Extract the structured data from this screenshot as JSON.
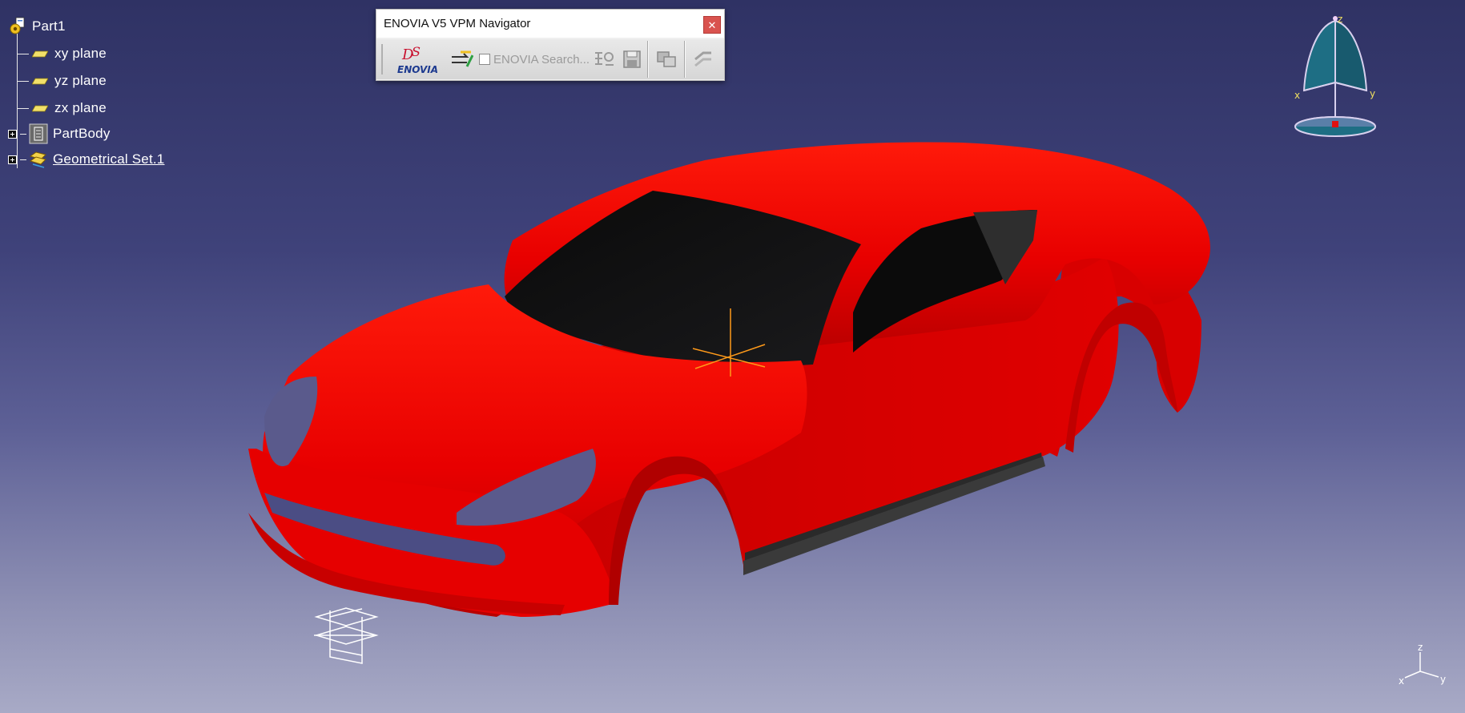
{
  "tree": {
    "root": "Part1",
    "items": [
      {
        "label": "xy plane"
      },
      {
        "label": "yz plane"
      },
      {
        "label": "zx plane"
      },
      {
        "label": "PartBody"
      },
      {
        "label": "Geometrical Set.1"
      }
    ]
  },
  "toolbar": {
    "title": "ENOVIA V5 VPM Navigator",
    "close_label": "✕",
    "logo_text": "ENOVIA",
    "search_label": "ENOVIA Search..."
  },
  "compass": {
    "x_label": "x",
    "y_label": "y",
    "z_label": "z"
  },
  "axes": {
    "x_label": "x",
    "y_label": "y",
    "z_label": "z"
  },
  "icons": [
    "part-icon",
    "plane-icon",
    "body-icon",
    "geometrical-set-icon",
    "ds-enovia-logo-icon",
    "navigator-icon",
    "search-checkbox",
    "tree-settings-icon",
    "save-icon",
    "sync-icon",
    "link-icon",
    "compass-icon",
    "axis-icon"
  ],
  "colors": {
    "car_body": "#e00000",
    "background_top": "#2f3264",
    "background_bottom": "#a8aac6"
  }
}
